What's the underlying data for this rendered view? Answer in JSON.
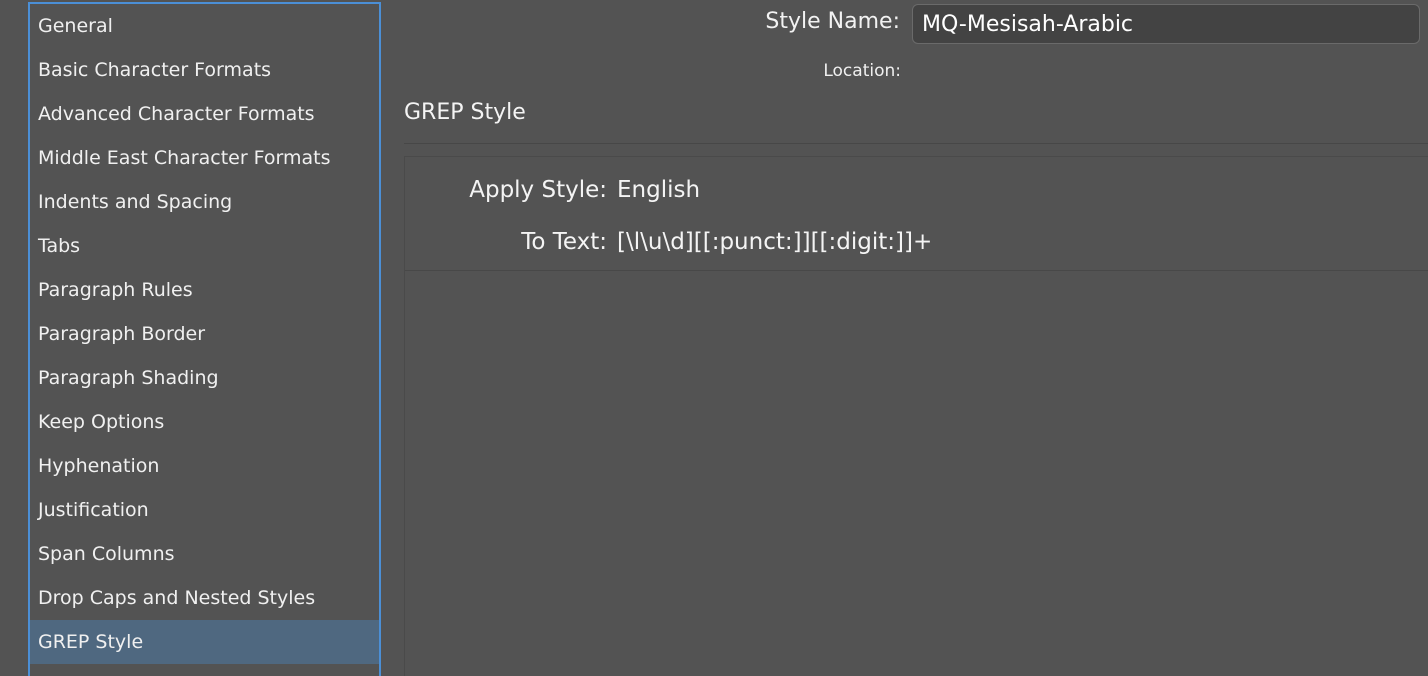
{
  "sidebar": {
    "items": [
      {
        "label": "General"
      },
      {
        "label": "Basic Character Formats"
      },
      {
        "label": "Advanced Character Formats"
      },
      {
        "label": "Middle East Character Formats"
      },
      {
        "label": "Indents and Spacing"
      },
      {
        "label": "Tabs"
      },
      {
        "label": "Paragraph Rules"
      },
      {
        "label": "Paragraph Border"
      },
      {
        "label": "Paragraph Shading"
      },
      {
        "label": "Keep Options"
      },
      {
        "label": "Hyphenation"
      },
      {
        "label": "Justification"
      },
      {
        "label": "Span Columns"
      },
      {
        "label": "Drop Caps and Nested Styles"
      },
      {
        "label": "GREP Style"
      }
    ],
    "selected_label": "GREP Style"
  },
  "header": {
    "style_name_label": "Style Name:",
    "style_name_value": "MQ-Mesisah-Arabic",
    "location_label": "Location:"
  },
  "section": {
    "title": "GREP Style"
  },
  "grep_rule": {
    "apply_style_label": "Apply Style:",
    "apply_style_value": "English",
    "to_text_label": "To Text:",
    "to_text_value": "[\\l\\u\\d][[:punct:]][[:digit:]]+"
  },
  "colors": {
    "background": "#535353",
    "selection": "#4f6880",
    "focus_border": "#4b8fd6"
  }
}
